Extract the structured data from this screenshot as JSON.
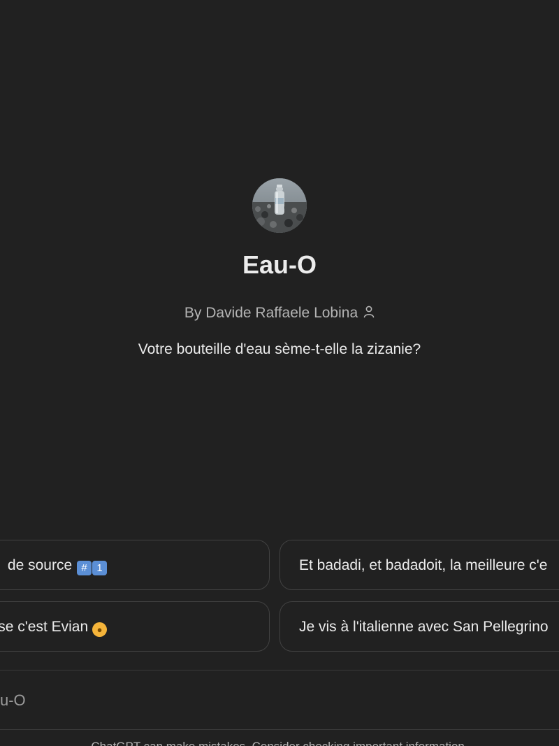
{
  "gpt": {
    "name": "Eau-O",
    "byline": "By Davide Raffaele Lobina",
    "description": "Votre bouteille d'eau sème-t-elle la zizanie?"
  },
  "conversation_starters": [
    {
      "text": "de source",
      "emoji": "#️⃣ 1️⃣"
    },
    {
      "text": "Et badadi, et badadoit, la meilleure c'e"
    },
    {
      "text": "esse c'est Evian",
      "emoji": "baby-face"
    },
    {
      "text": "Je vis à l'italienne avec San Pellegrino"
    }
  ],
  "icons": {
    "author": "person-icon",
    "avatar": "water-bottle-image"
  },
  "composer": {
    "placeholder": "u-O"
  },
  "footer": {
    "note": "ChatGPT can make mistakes. Consider checking important information."
  },
  "colors": {
    "background": "#212121",
    "text": "#ececec",
    "muted_text": "#b4b4b4",
    "border": "#424242"
  }
}
